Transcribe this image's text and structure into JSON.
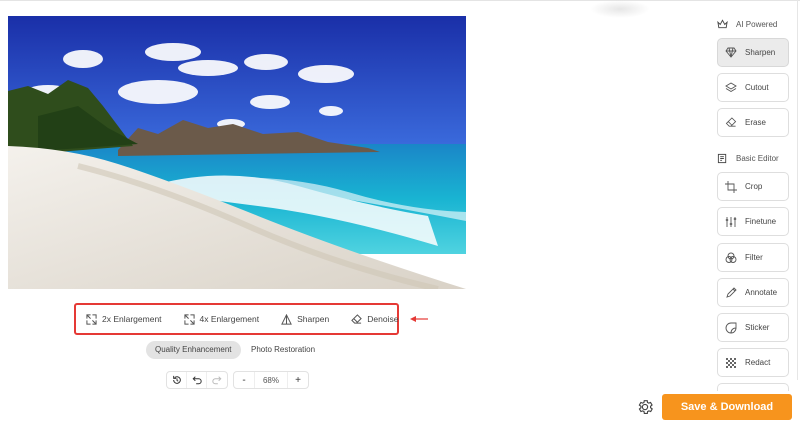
{
  "image": {
    "alt": ""
  },
  "enhance_tools": [
    {
      "label": "2x Enlargement",
      "icon": "expand-arrows-icon"
    },
    {
      "label": "4x Enlargement",
      "icon": "expand-arrows-icon"
    },
    {
      "label": "Sharpen",
      "icon": "sharpen-triangle-icon"
    },
    {
      "label": "Denoise",
      "icon": "eraser-icon"
    }
  ],
  "modes": {
    "quality": "Quality Enhancement",
    "restoration": "Photo Restoration",
    "active": "quality"
  },
  "zoom": {
    "value": "68%",
    "minus": "-",
    "plus": "+"
  },
  "history": {
    "reset_icon": "history-icon",
    "undo_icon": "undo-icon",
    "redo_icon": "redo-icon",
    "redo_enabled": false
  },
  "sidebar": {
    "ai_section": {
      "label": "AI Powered",
      "icon": "crown-icon"
    },
    "ai_items": [
      {
        "label": "Sharpen",
        "icon": "diamond-icon",
        "active": true
      },
      {
        "label": "Cutout",
        "icon": "layers-icon",
        "active": false
      },
      {
        "label": "Erase",
        "icon": "eraser-icon",
        "active": false
      }
    ],
    "basic_section": {
      "label": "Basic Editor",
      "icon": "editor-icon"
    },
    "basic_items": [
      {
        "label": "Crop",
        "icon": "crop-icon"
      },
      {
        "label": "Finetune",
        "icon": "sliders-icon"
      },
      {
        "label": "Filter",
        "icon": "filter-circles-icon"
      },
      {
        "label": "Annotate",
        "icon": "pen-icon"
      },
      {
        "label": "Sticker",
        "icon": "sticker-icon"
      },
      {
        "label": "Redact",
        "icon": "redact-icon"
      }
    ]
  },
  "footer": {
    "save_label": "Save & Download",
    "settings_icon": "gear-icon"
  },
  "colors": {
    "accent": "#f7941d",
    "highlight_box": "#e53935",
    "active_card": "#ebebeb"
  }
}
